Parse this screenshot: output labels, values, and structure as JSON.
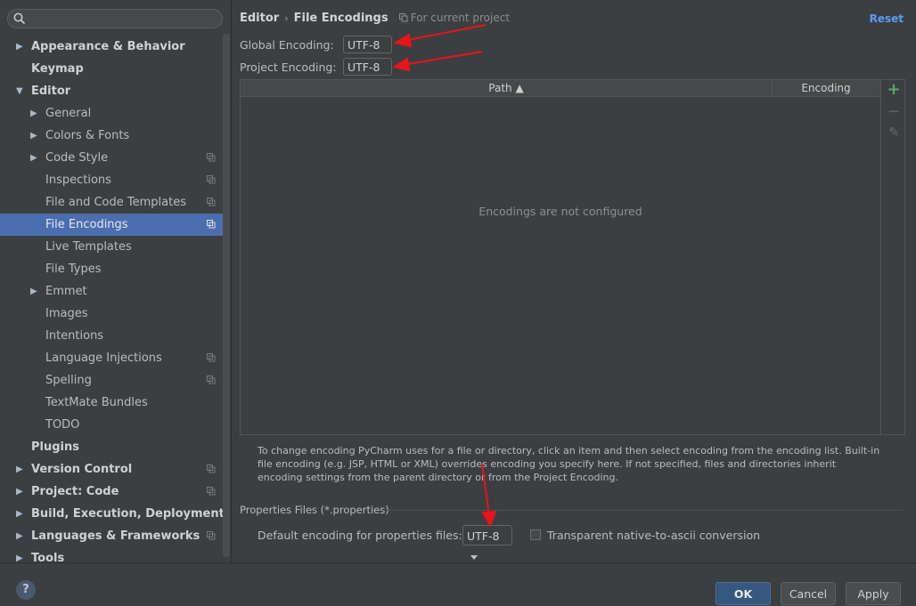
{
  "search": {
    "placeholder": ""
  },
  "sidebar": {
    "items": [
      {
        "label": "Appearance & Behavior",
        "level": 0,
        "arrow": "▶",
        "copy": false,
        "selected": false
      },
      {
        "label": "Keymap",
        "level": 0,
        "arrow": "",
        "copy": false,
        "selected": false
      },
      {
        "label": "Editor",
        "level": 0,
        "arrow": "▼",
        "copy": false,
        "selected": false
      },
      {
        "label": "General",
        "level": 1,
        "arrow": "▶",
        "copy": false,
        "selected": false
      },
      {
        "label": "Colors & Fonts",
        "level": 1,
        "arrow": "▶",
        "copy": false,
        "selected": false
      },
      {
        "label": "Code Style",
        "level": 1,
        "arrow": "▶",
        "copy": true,
        "selected": false
      },
      {
        "label": "Inspections",
        "level": 1,
        "arrow": "",
        "copy": true,
        "selected": false
      },
      {
        "label": "File and Code Templates",
        "level": 1,
        "arrow": "",
        "copy": true,
        "selected": false
      },
      {
        "label": "File Encodings",
        "level": 1,
        "arrow": "",
        "copy": true,
        "selected": true
      },
      {
        "label": "Live Templates",
        "level": 1,
        "arrow": "",
        "copy": false,
        "selected": false
      },
      {
        "label": "File Types",
        "level": 1,
        "arrow": "",
        "copy": false,
        "selected": false
      },
      {
        "label": "Emmet",
        "level": 1,
        "arrow": "▶",
        "copy": false,
        "selected": false
      },
      {
        "label": "Images",
        "level": 1,
        "arrow": "",
        "copy": false,
        "selected": false
      },
      {
        "label": "Intentions",
        "level": 1,
        "arrow": "",
        "copy": false,
        "selected": false
      },
      {
        "label": "Language Injections",
        "level": 1,
        "arrow": "",
        "copy": true,
        "selected": false
      },
      {
        "label": "Spelling",
        "level": 1,
        "arrow": "",
        "copy": true,
        "selected": false
      },
      {
        "label": "TextMate Bundles",
        "level": 1,
        "arrow": "",
        "copy": false,
        "selected": false
      },
      {
        "label": "TODO",
        "level": 1,
        "arrow": "",
        "copy": false,
        "selected": false
      },
      {
        "label": "Plugins",
        "level": 0,
        "arrow": "",
        "copy": false,
        "selected": false
      },
      {
        "label": "Version Control",
        "level": 0,
        "arrow": "▶",
        "copy": true,
        "selected": false
      },
      {
        "label": "Project: Code",
        "level": 0,
        "arrow": "▶",
        "copy": true,
        "selected": false
      },
      {
        "label": "Build, Execution, Deployment",
        "level": 0,
        "arrow": "▶",
        "copy": false,
        "selected": false
      },
      {
        "label": "Languages & Frameworks",
        "level": 0,
        "arrow": "▶",
        "copy": true,
        "selected": false
      },
      {
        "label": "Tools",
        "level": 0,
        "arrow": "▶",
        "copy": false,
        "selected": false
      }
    ]
  },
  "header": {
    "crumb_parent": "Editor",
    "crumb_sep": "›",
    "crumb_current": "File Encodings",
    "scope": "For current project",
    "reset": "Reset"
  },
  "encoding": {
    "global_label": "Global Encoding:",
    "global_value": "UTF-8",
    "project_label": "Project Encoding:",
    "project_value": "UTF-8"
  },
  "table": {
    "col_path": "Path ▲",
    "col_encoding": "Encoding",
    "empty": "Encodings are not configured"
  },
  "toolbar": {
    "add": "+",
    "remove": "−",
    "edit": "✎"
  },
  "help_text": "To change encoding PyCharm uses for a file or directory, click an item and then select encoding from the encoding list. Built-in file encoding (e.g. JSP, HTML or XML) overrides encoding you specify here. If not specified, files and directories inherit encoding settings from the parent directory or from the Project Encoding.",
  "properties": {
    "group_title": "Properties Files (*.properties)",
    "default_label": "Default encoding for properties files:",
    "default_value": "UTF-8",
    "transparent_label": "Transparent native-to-ascii conversion",
    "transparent_checked": false
  },
  "footer": {
    "help": "?",
    "ok": "OK",
    "cancel": "Cancel",
    "apply": "Apply"
  },
  "colors": {
    "accent": "#4b6eaf",
    "link": "#589df6",
    "annotation_red": "#e8141a"
  }
}
